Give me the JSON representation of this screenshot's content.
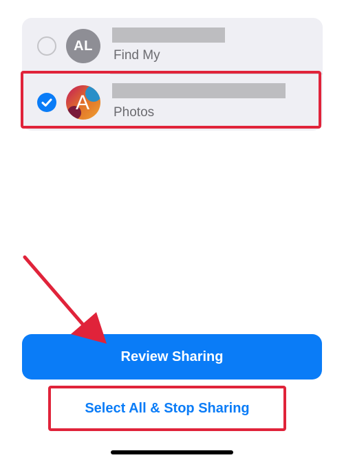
{
  "contacts": [
    {
      "initials": "AL",
      "subtitle": "Find My",
      "selected": false,
      "avatar_color": "#8e8e95"
    },
    {
      "initials": "A",
      "subtitle": "Photos",
      "selected": true,
      "avatar_type": "photo"
    }
  ],
  "actions": {
    "review_sharing_label": "Review Sharing",
    "select_all_stop_sharing_label": "Select All & Stop Sharing"
  },
  "colors": {
    "accent_blue": "#0a7cf7",
    "annotation_red": "#e0233a",
    "card_background": "#efeff4",
    "redaction_gray": "#bdbdc0"
  },
  "annotations": {
    "arrow_icon": "red-arrow-icon",
    "highlight_boxes": [
      "photos-contact-row",
      "select-all-stop-sharing-button"
    ]
  }
}
